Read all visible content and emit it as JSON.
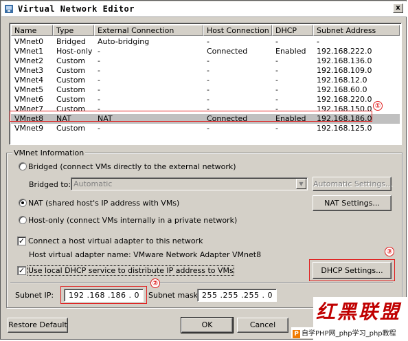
{
  "window": {
    "title": "Virtual Network Editor",
    "close_label": "x"
  },
  "network_table": {
    "columns": [
      "Name",
      "Type",
      "External Connection",
      "Host Connection",
      "DHCP",
      "Subnet Address"
    ],
    "rows": [
      [
        "VMnet0",
        "Bridged",
        "Auto-bridging",
        "-",
        "-",
        "-"
      ],
      [
        "VMnet1",
        "Host-only",
        "-",
        "Connected",
        "Enabled",
        "192.168.222.0"
      ],
      [
        "VMnet2",
        "Custom",
        "-",
        "-",
        "-",
        "192.168.136.0"
      ],
      [
        "VMnet3",
        "Custom",
        "-",
        "-",
        "-",
        "192.168.109.0"
      ],
      [
        "VMnet4",
        "Custom",
        "-",
        "-",
        "-",
        "192.168.12.0"
      ],
      [
        "VMnet5",
        "Custom",
        "-",
        "-",
        "-",
        "192.168.60.0"
      ],
      [
        "VMnet6",
        "Custom",
        "-",
        "-",
        "-",
        "192.168.220.0"
      ],
      [
        "VMnet7",
        "Custom",
        "-",
        "-",
        "-",
        "192.168.150.0"
      ],
      [
        "VMnet8",
        "NAT",
        "NAT",
        "Connected",
        "Enabled",
        "192.168.186.0"
      ],
      [
        "VMnet9",
        "Custom",
        "-",
        "-",
        "-",
        "192.168.125.0"
      ]
    ],
    "selected_row": "VMnet8"
  },
  "annotations": {
    "marker1": "①",
    "marker2": "②",
    "marker3": "③",
    "color": "#e02020"
  },
  "vmnet_info": {
    "group_label": "VMnet Information",
    "bridged_label": "Bridged (connect VMs directly to the external network)",
    "bridged_to_label": "Bridged to:",
    "bridged_to_value": "Automatic",
    "auto_settings_label": "Automatic Settings...",
    "nat_label": "NAT (shared host's IP address with VMs)",
    "nat_settings_label": "NAT Settings...",
    "hostonly_label": "Host-only (connect VMs internally in a private network)",
    "selected_mode": "NAT",
    "connect_adapter_label": "Connect a host virtual adapter to this network",
    "connect_adapter_checked": true,
    "adapter_name_label": "Host virtual adapter name: VMware Network Adapter VMnet8",
    "use_dhcp_label": "Use local DHCP service to distribute IP address to VMs",
    "use_dhcp_checked": true,
    "dhcp_settings_label": "DHCP Settings...",
    "subnet_ip_label": "Subnet IP:",
    "subnet_ip_value": "192 .168 .186 . 0",
    "subnet_mask_label": "Subnet mask:",
    "subnet_mask_value": "255 .255 .255 . 0"
  },
  "footer": {
    "restore_label": "Restore Default",
    "ok_label": "OK",
    "cancel_label": "Cancel"
  },
  "watermark": {
    "brand": "红黑联盟",
    "php_badge": "P",
    "caption": "自学PHP网_php学习_php教程"
  }
}
